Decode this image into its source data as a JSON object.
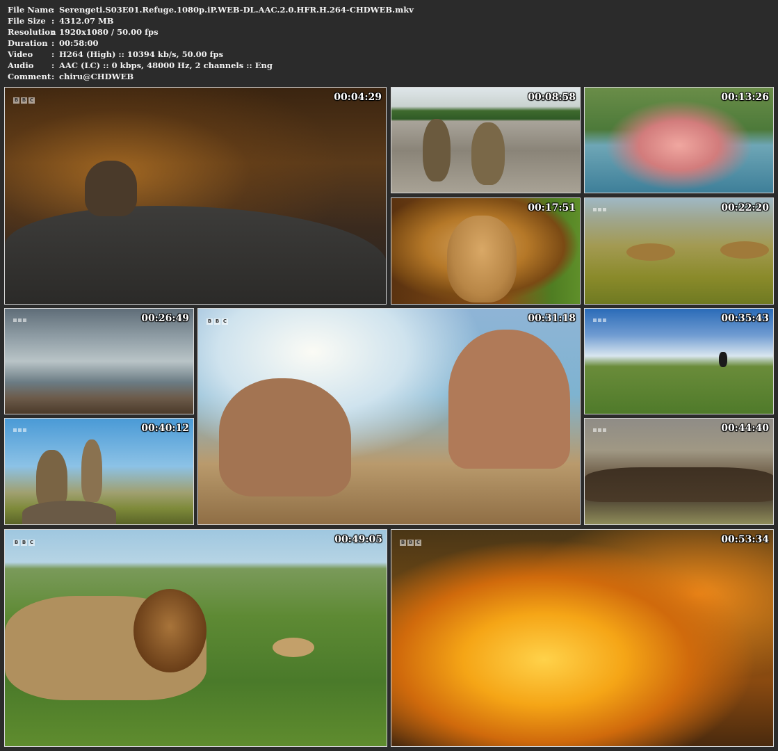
{
  "info": [
    {
      "key": "File Name",
      "value": "Serengeti.S03E01.Refuge.1080p.iP.WEB-DL.AAC.2.0.HFR.H.264-CHDWEB.mkv"
    },
    {
      "key": "File Size",
      "value": "4312.07 MB"
    },
    {
      "key": "Resolution",
      "value": "1920x1080 / 50.00 fps"
    },
    {
      "key": "Duration",
      "value": "00:58:00"
    },
    {
      "key": "Video",
      "value": "H264 (High) :: 10394 kb/s, 50.00 fps"
    },
    {
      "key": "Audio",
      "value": "AAC (LC) :: 0 kbps, 48000 Hz, 2 channels :: Eng"
    },
    {
      "key": "Comment",
      "value": "chiru@CHDWEB"
    }
  ],
  "separator": ":",
  "logo_text": [
    "B",
    "B",
    "C"
  ],
  "thumbnails": [
    {
      "timestamp": "00:04:29"
    },
    {
      "timestamp": "00:08:58"
    },
    {
      "timestamp": "00:13:26"
    },
    {
      "timestamp": "00:17:51"
    },
    {
      "timestamp": "00:22:20"
    },
    {
      "timestamp": "00:26:49"
    },
    {
      "timestamp": "00:31:18"
    },
    {
      "timestamp": "00:35:43"
    },
    {
      "timestamp": "00:40:12"
    },
    {
      "timestamp": "00:44:40"
    },
    {
      "timestamp": "00:49:05"
    },
    {
      "timestamp": "00:53:34"
    }
  ]
}
